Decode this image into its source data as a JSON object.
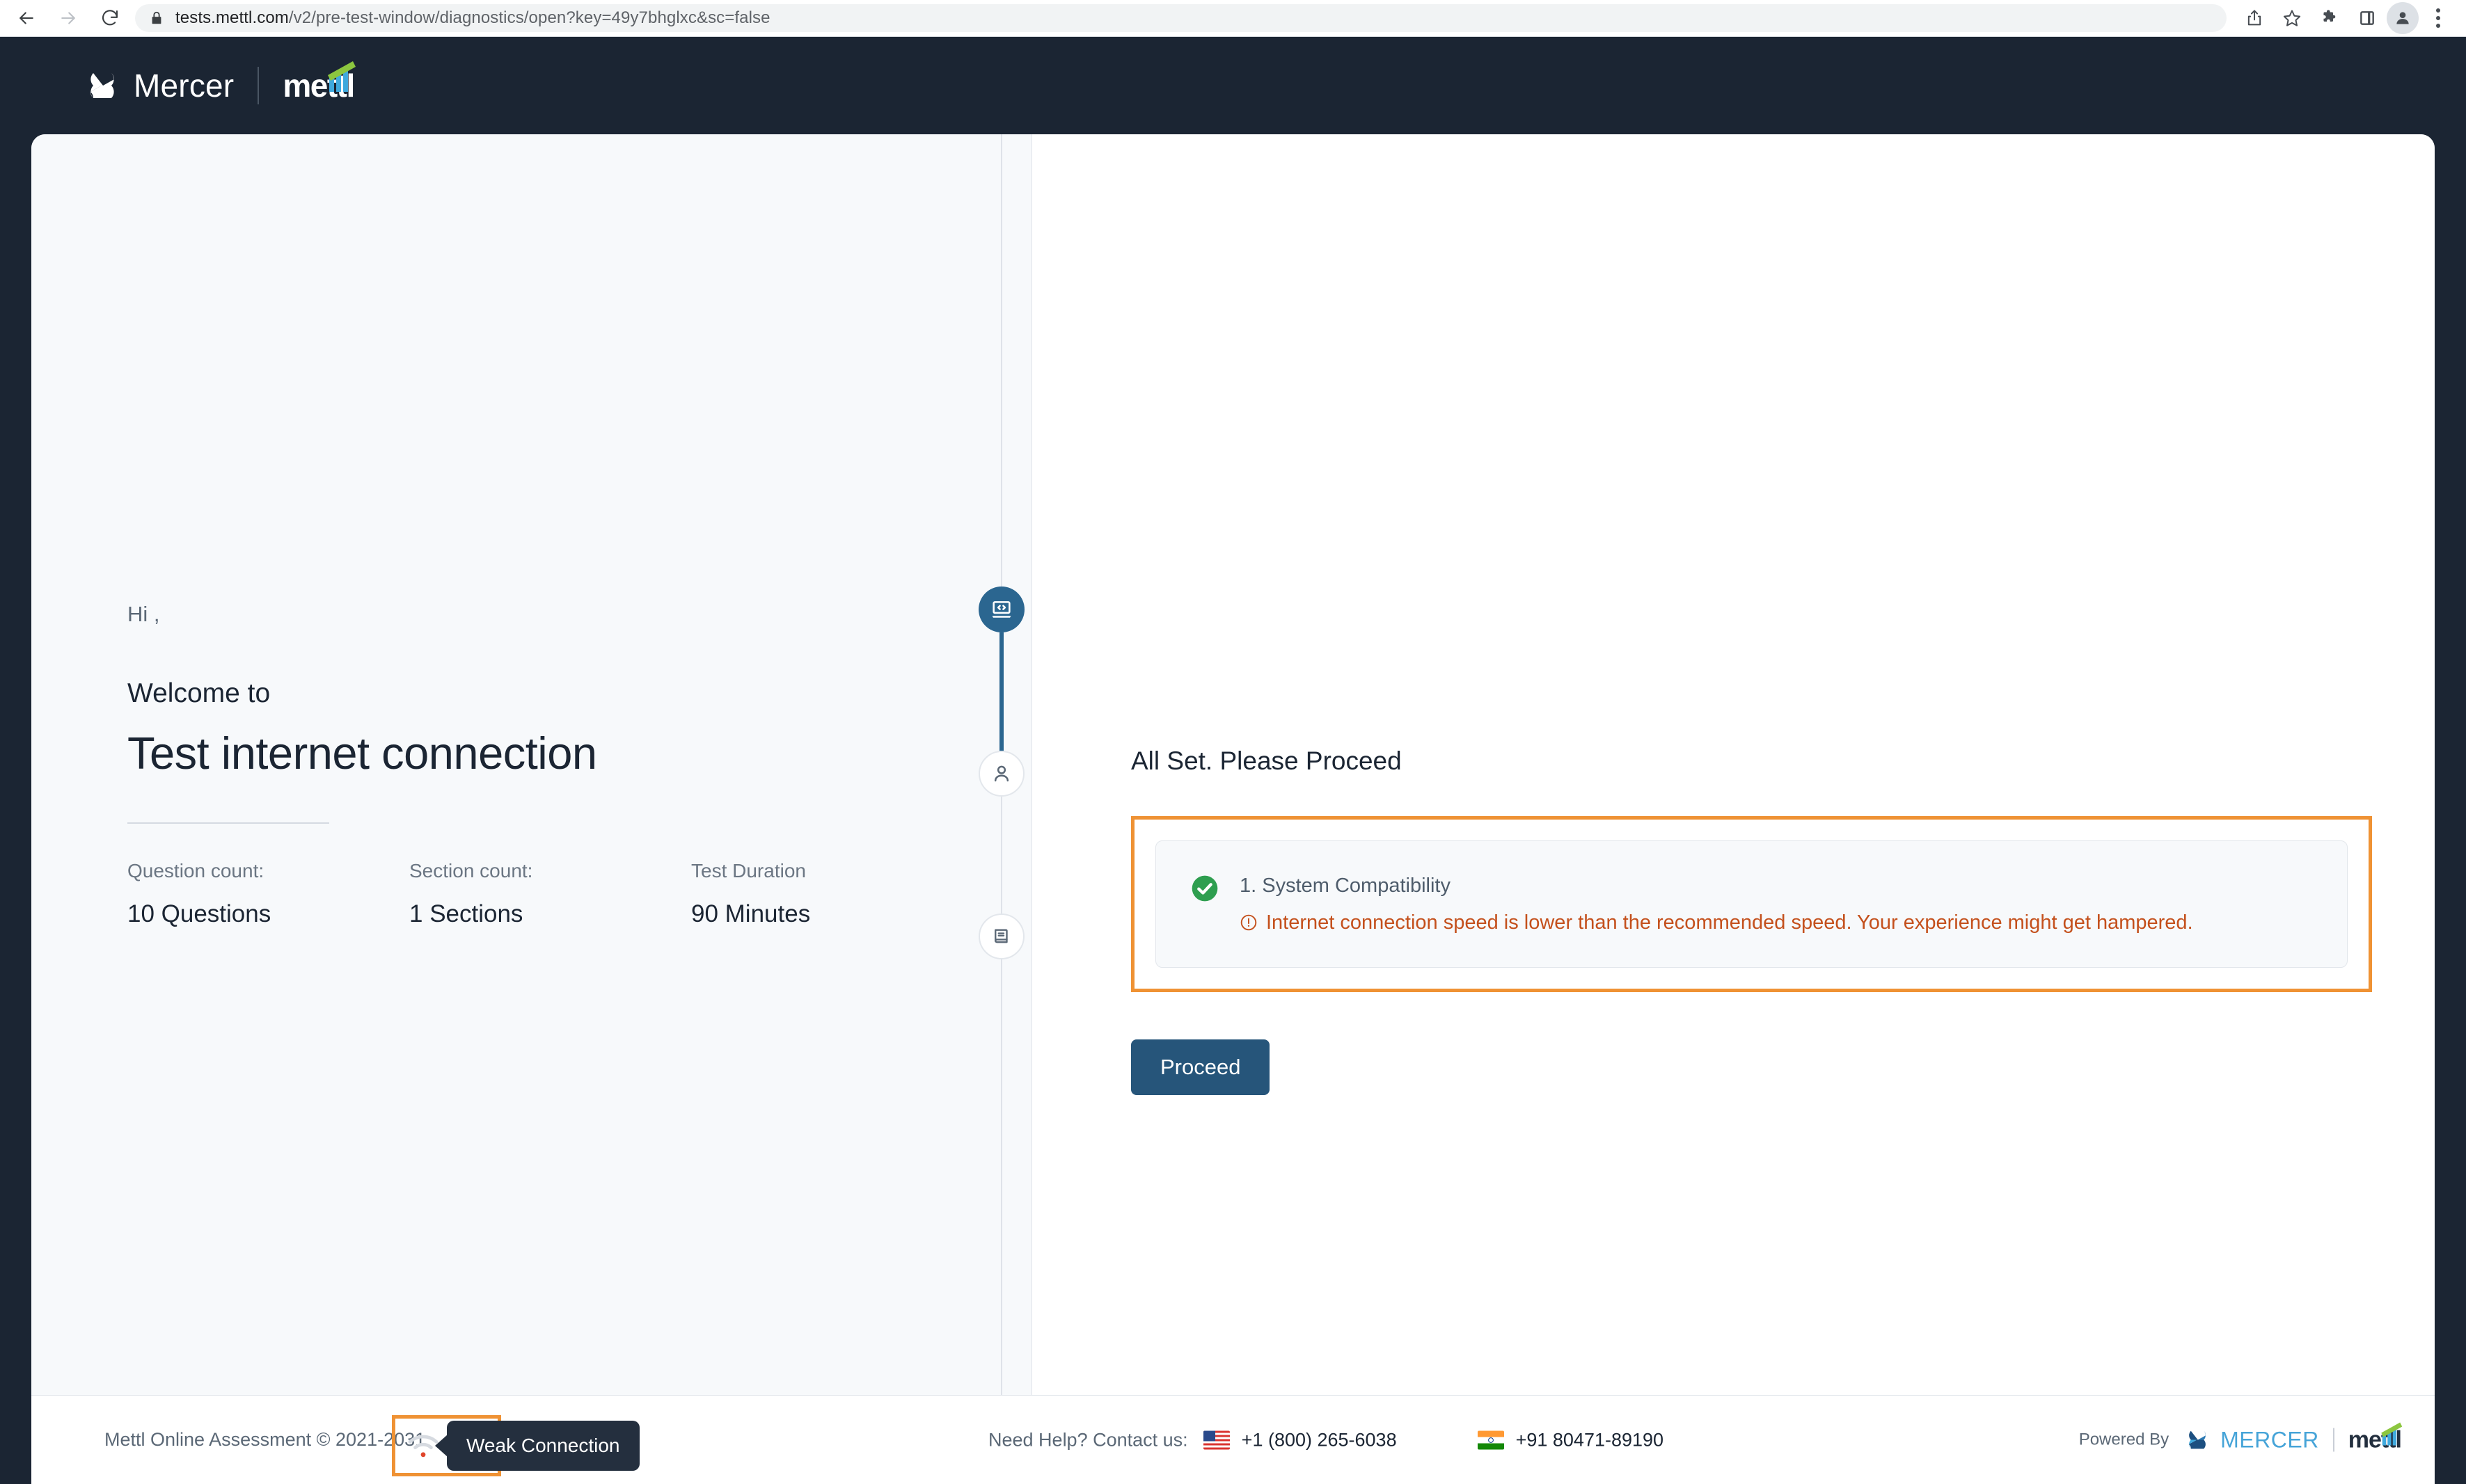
{
  "browser": {
    "url_host": "tests.mettl.com",
    "url_path": "/v2/pre-test-window/diagnostics/open?key=49y7bhglxc&sc=false",
    "back_icon": "back-arrow-icon",
    "forward_icon": "forward-arrow-icon",
    "reload_icon": "reload-icon",
    "lock_icon": "lock-icon",
    "share_icon": "share-icon",
    "bookmark_icon": "star-icon",
    "extensions_icon": "puzzle-icon",
    "sidepanel_icon": "side-panel-icon",
    "profile_icon": "profile-avatar-icon",
    "menu_icon": "three-dot-menu-icon"
  },
  "header": {
    "mercer_text": "Mercer",
    "mettl_text": "mettl"
  },
  "left": {
    "greeting": "Hi ,",
    "welcome_to": "Welcome to",
    "title": "Test internet connection",
    "stats": [
      {
        "label": "Question count:",
        "value": "10 Questions"
      },
      {
        "label": "Section count:",
        "value": "1 Sections"
      },
      {
        "label": "Test Duration",
        "value": "90  Minutes"
      }
    ]
  },
  "stepper": {
    "steps": [
      {
        "icon": "laptop-code-icon",
        "state": "active"
      },
      {
        "icon": "person-icon",
        "state": "idle"
      },
      {
        "icon": "book-icon",
        "state": "idle"
      }
    ]
  },
  "right": {
    "heading": "All Set. Please Proceed",
    "check": {
      "status_icon": "green-check-circle-icon",
      "title": "1. System Compatibility",
      "warning_icon": "warning-circle-icon",
      "warning": "Internet connection speed is lower than the recommended speed. Your experience might get hampered."
    },
    "proceed_label": "Proceed"
  },
  "footer": {
    "copyright": "Mettl Online Assessment © 2021-2031",
    "connection_icon": "wifi-weak-icon",
    "connection_tooltip": "Weak Connection",
    "help_label": "Need Help? Contact us:",
    "phones": [
      {
        "flag": "us-flag-icon",
        "number": "+1 (800) 265-6038"
      },
      {
        "flag": "in-flag-icon",
        "number": "+91 80471-89190"
      }
    ],
    "powered_label": "Powered By",
    "powered_mercer": "MERCER",
    "powered_mettl": "mettl"
  },
  "colors": {
    "header_bg": "#1b2533",
    "accent_blue": "#26557a",
    "highlight_orange": "#ef9234",
    "warning_text": "#c4501c",
    "success_green": "#2e9e4f"
  }
}
